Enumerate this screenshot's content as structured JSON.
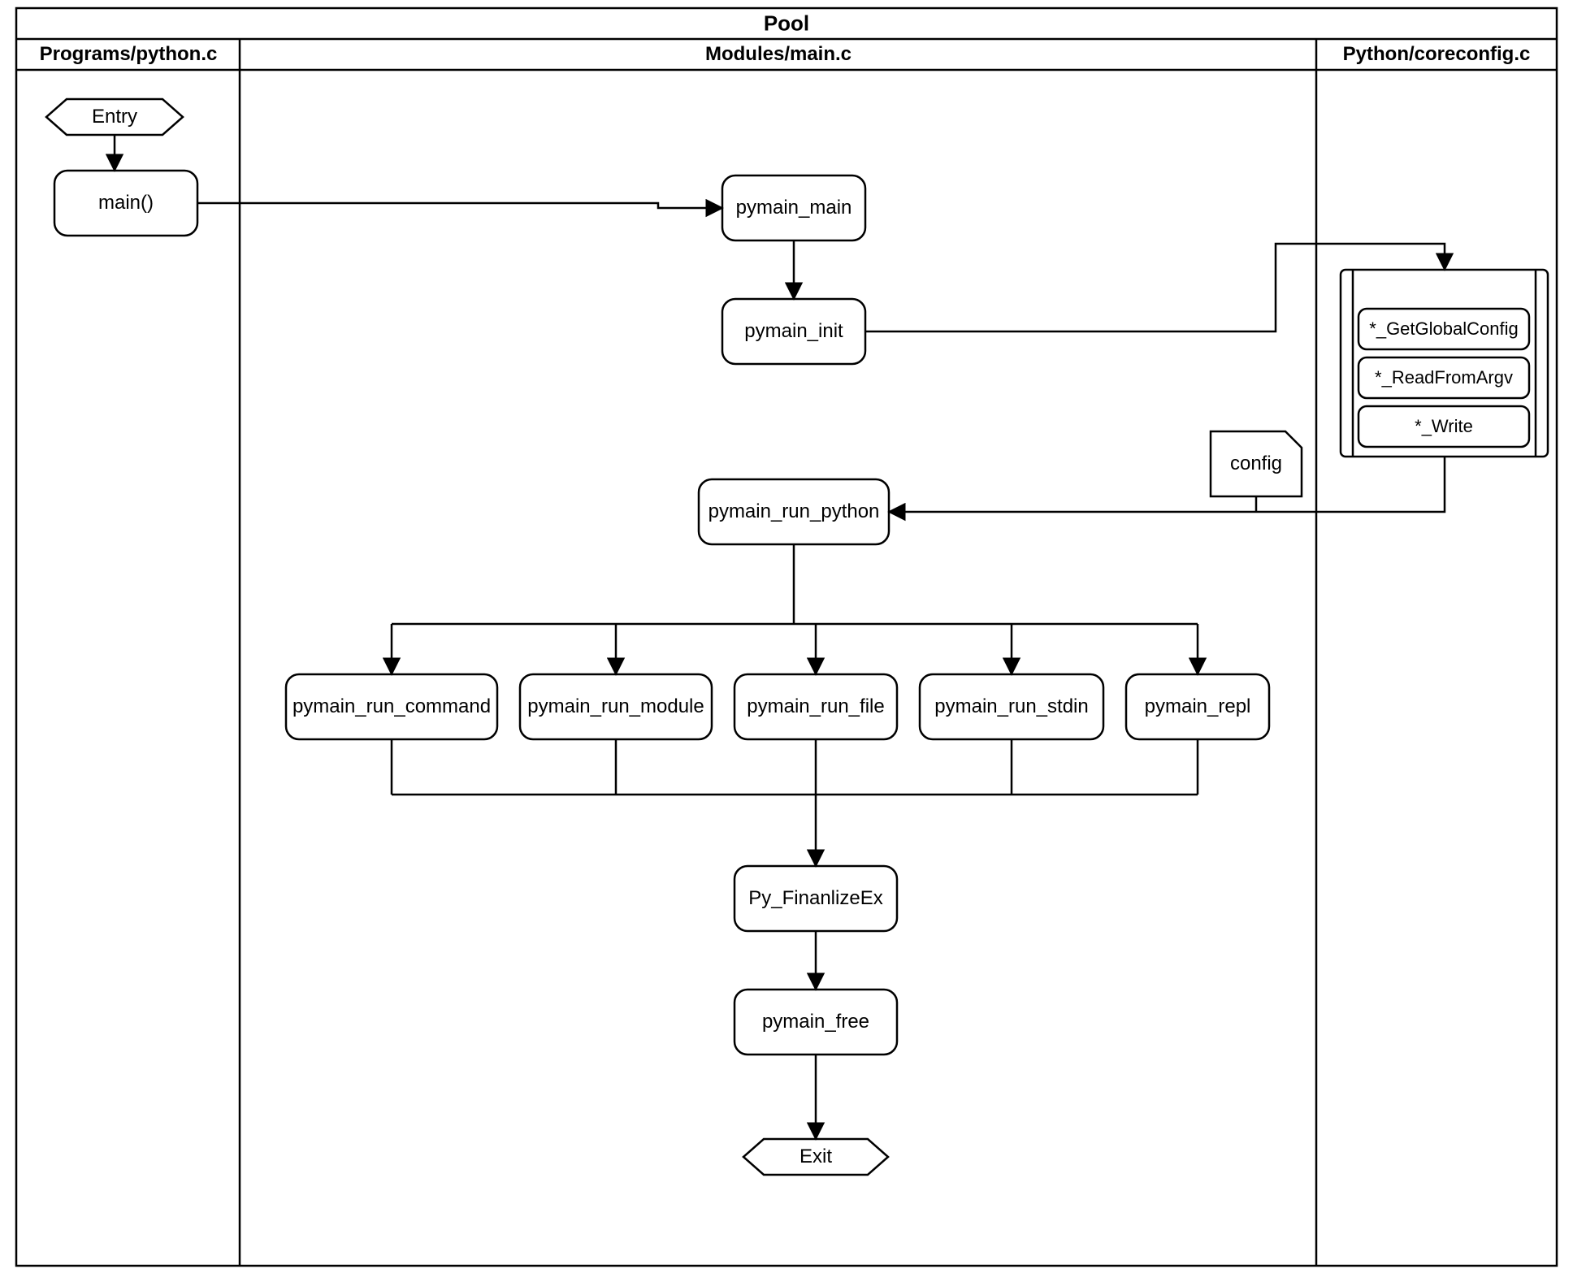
{
  "diagram": {
    "title": "Pool",
    "lanes": {
      "left_header": "Programs/python.c",
      "mid_header": "Modules/main.c",
      "right_header": "Python/coreconfig.c"
    },
    "nodes": {
      "entry": "Entry",
      "main": "main()",
      "pymain_main": "pymain_main",
      "pymain_init": "pymain_init",
      "config": "config",
      "getglobalconfig": "*_GetGlobalConfig",
      "readfromargv": "*_ReadFromArgv",
      "write": "*_Write",
      "pymain_run_python": "pymain_run_python",
      "pymain_run_command": "pymain_run_command",
      "pymain_run_module": "pymain_run_module",
      "pymain_run_file": "pymain_run_file",
      "pymain_run_stdin": "pymain_run_stdin",
      "pymain_repl": "pymain_repl",
      "py_finalizeex": "Py_FinanlizeEx",
      "pymain_free": "pymain_free",
      "exit": "Exit"
    }
  }
}
